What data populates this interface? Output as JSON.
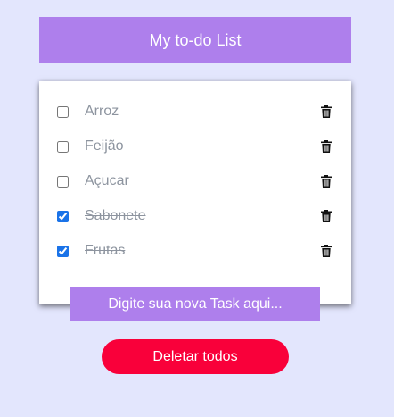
{
  "header": {
    "title": "My to-do List"
  },
  "tasks": [
    {
      "label": "Arroz",
      "done": false
    },
    {
      "label": "Feijão",
      "done": false
    },
    {
      "label": "Açucar",
      "done": false
    },
    {
      "label": "Sabonete",
      "done": true
    },
    {
      "label": "Frutas",
      "done": true
    }
  ],
  "new_task": {
    "placeholder": "Digite sua nova Task aqui...",
    "value": ""
  },
  "actions": {
    "delete_all_label": "Deletar todos"
  },
  "colors": {
    "background": "#e3e6fd",
    "accent": "#ae7fec",
    "danger": "#f9003a",
    "checkbox": "#1a73e8",
    "task_text": "#8d949f"
  },
  "icons": {
    "task_delete": "trash-icon"
  }
}
